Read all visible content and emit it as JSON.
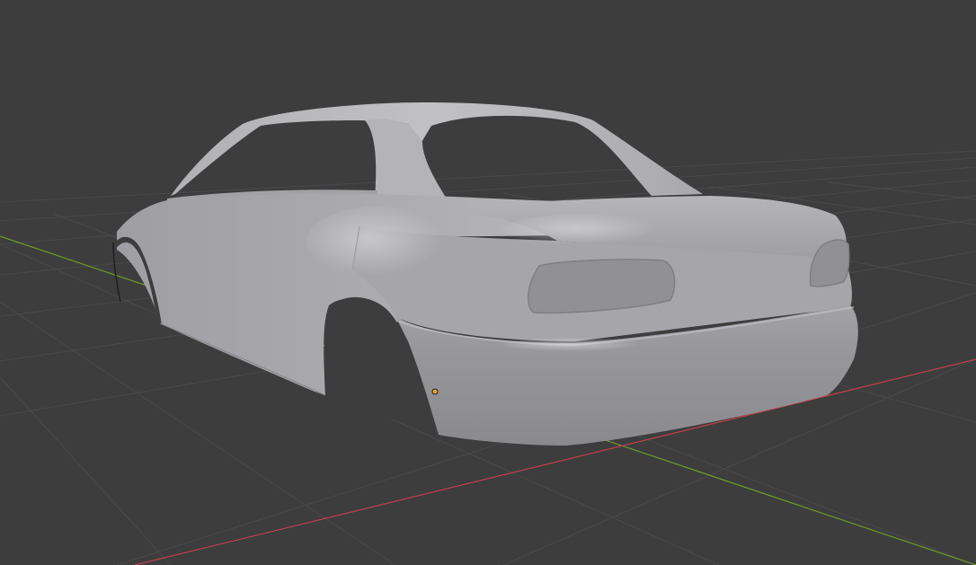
{
  "viewport": {
    "background_color": "#3d3d3d",
    "grid_line_color": "#4c4c4c",
    "x_axis_color": "#c0414f",
    "y_axis_color": "#6e9a2b",
    "model_color": "#a8a8ab",
    "origin_marker_color": "#f0a030",
    "view": "perspective",
    "shading": "solid",
    "object": "car body shell"
  }
}
